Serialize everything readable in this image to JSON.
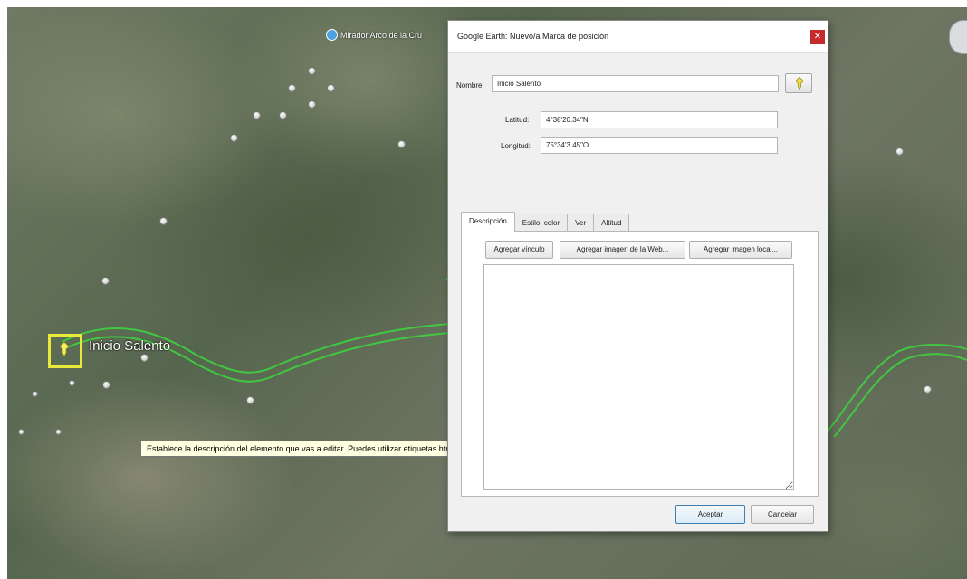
{
  "map": {
    "poi_label": "Mirador Arco de la Cru",
    "placemark_label": "Inicio Salento",
    "tooltip": "Establece la descripción del elemento que vas a editar. Puedes utilizar etiquetas html e incluir direcciones URL.",
    "trail_color": "#3fd23f",
    "selection_color": "#e9e93a"
  },
  "dialog": {
    "title": "Google Earth: Nuevo/a Marca de posición",
    "close_icon": "close-icon",
    "name_label": "Nombre:",
    "name_value": "Inicio Salento",
    "latitude_label": "Latitud:",
    "latitude_value": "4°38'20.34\"N",
    "longitude_label": "Longitud:",
    "longitude_value": "75°34'3.45\"O",
    "tabs": [
      {
        "label": "Descripción",
        "active": true
      },
      {
        "label": "Estilo, color",
        "active": false
      },
      {
        "label": "Ver",
        "active": false
      },
      {
        "label": "Altitud",
        "active": false
      }
    ],
    "add_link_label": "Agregar vínculo",
    "add_web_image_label": "Agregar imagen de la Web...",
    "add_local_image_label": "Agregar imagen local...",
    "accept_label": "Aceptar",
    "cancel_label": "Cancelar"
  }
}
